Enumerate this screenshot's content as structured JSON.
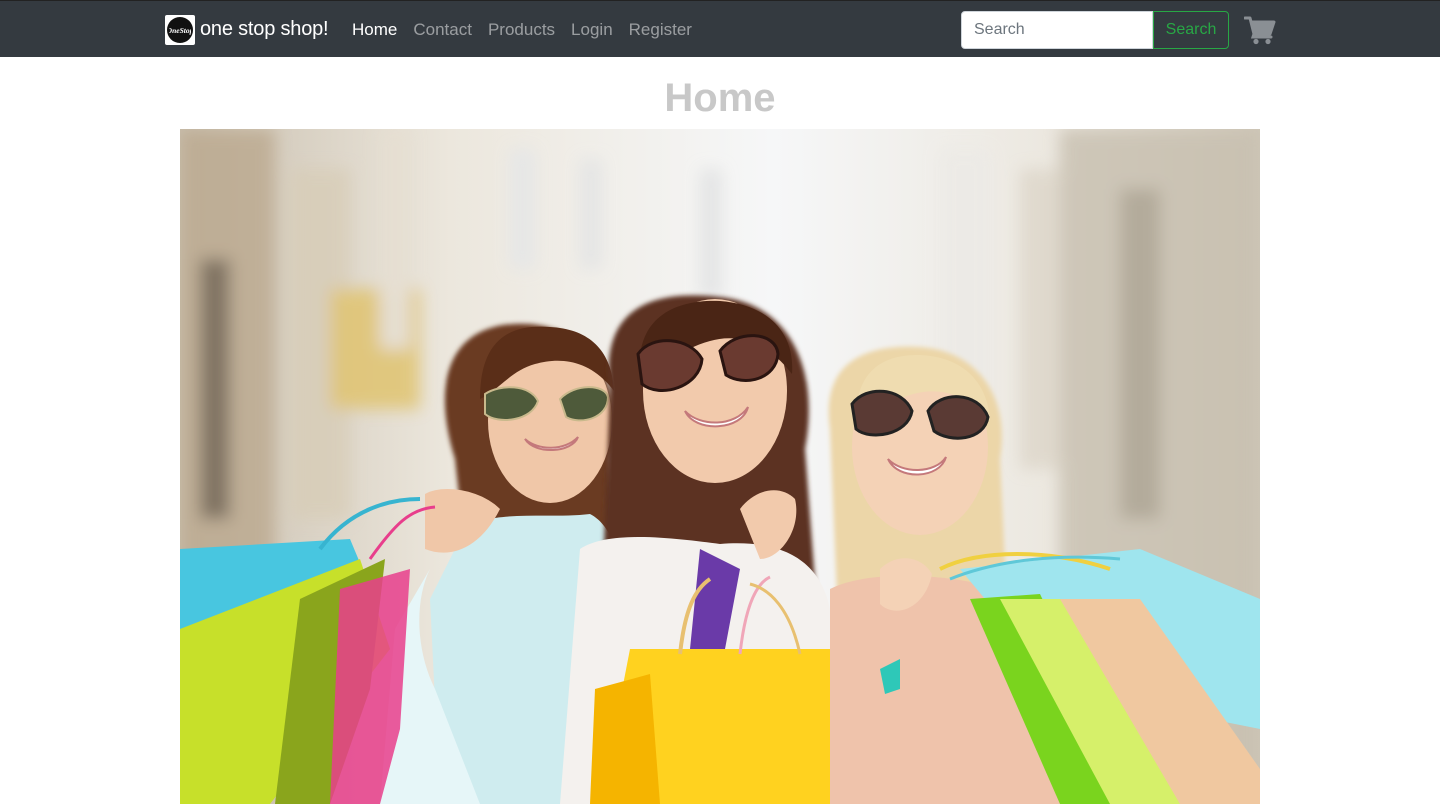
{
  "navbar": {
    "brand_name": "one stop shop!",
    "logo_text": "OneStop",
    "links": [
      {
        "label": "Home",
        "active": true
      },
      {
        "label": "Contact",
        "active": false
      },
      {
        "label": "Products",
        "active": false
      },
      {
        "label": "Login",
        "active": false
      },
      {
        "label": "Register",
        "active": false
      }
    ],
    "search": {
      "placeholder": "Search",
      "button_label": "Search"
    },
    "cart_icon": "shopping-cart-icon"
  },
  "main": {
    "title": "Home",
    "hero_image": "hero-shopping-photo"
  },
  "colors": {
    "navbar_bg": "#343a40",
    "accent_green": "#28a745",
    "title_gray": "#c8c8c8"
  }
}
